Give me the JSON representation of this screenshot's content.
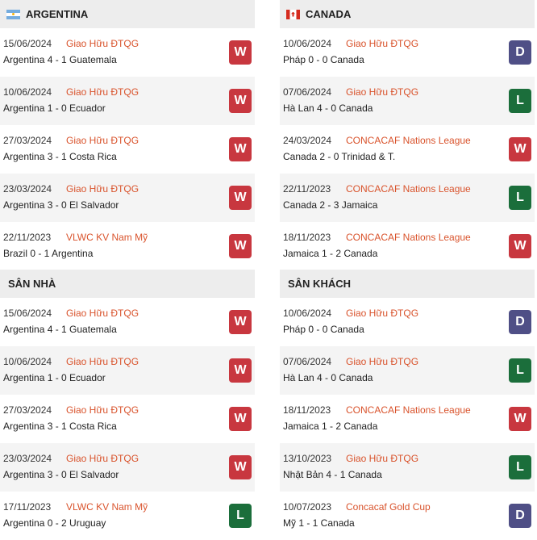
{
  "argentina": {
    "title": "ARGENTINA",
    "flag_icon": "argentina-flag-icon",
    "matches": [
      {
        "date": "15/06/2024",
        "competition": "Giao Hữu ĐTQG",
        "score": "Argentina 4 - 1 Guatemala",
        "result": "W"
      },
      {
        "date": "10/06/2024",
        "competition": "Giao Hữu ĐTQG",
        "score": "Argentina 1 - 0 Ecuador",
        "result": "W"
      },
      {
        "date": "27/03/2024",
        "competition": "Giao Hữu ĐTQG",
        "score": "Argentina 3 - 1 Costa Rica",
        "result": "W"
      },
      {
        "date": "23/03/2024",
        "competition": "Giao Hữu ĐTQG",
        "score": "Argentina 3 - 0 El Salvador",
        "result": "W"
      },
      {
        "date": "22/11/2023",
        "competition": "VLWC KV Nam Mỹ",
        "score": "Brazil 0 - 1 Argentina",
        "result": "W"
      }
    ]
  },
  "canada": {
    "title": "CANADA",
    "flag_icon": "canada-flag-icon",
    "matches": [
      {
        "date": "10/06/2024",
        "competition": "Giao Hữu ĐTQG",
        "score": "Pháp 0 - 0 Canada",
        "result": "D"
      },
      {
        "date": "07/06/2024",
        "competition": "Giao Hữu ĐTQG",
        "score": "Hà Lan 4 - 0 Canada",
        "result": "L"
      },
      {
        "date": "24/03/2024",
        "competition": "CONCACAF Nations League",
        "score": "Canada 2 - 0 Trinidad & T.",
        "result": "W"
      },
      {
        "date": "22/11/2023",
        "competition": "CONCACAF Nations League",
        "score": "Canada 2 - 3 Jamaica",
        "result": "L"
      },
      {
        "date": "18/11/2023",
        "competition": "CONCACAF Nations League",
        "score": "Jamaica 1 - 2 Canada",
        "result": "W"
      }
    ]
  },
  "home": {
    "title": "SÂN NHÀ",
    "matches": [
      {
        "date": "15/06/2024",
        "competition": "Giao Hữu ĐTQG",
        "score": "Argentina 4 - 1 Guatemala",
        "result": "W"
      },
      {
        "date": "10/06/2024",
        "competition": "Giao Hữu ĐTQG",
        "score": "Argentina 1 - 0 Ecuador",
        "result": "W"
      },
      {
        "date": "27/03/2024",
        "competition": "Giao Hữu ĐTQG",
        "score": "Argentina 3 - 1 Costa Rica",
        "result": "W"
      },
      {
        "date": "23/03/2024",
        "competition": "Giao Hữu ĐTQG",
        "score": "Argentina 3 - 0 El Salvador",
        "result": "W"
      },
      {
        "date": "17/11/2023",
        "competition": "VLWC KV Nam Mỹ",
        "score": "Argentina 0 - 2 Uruguay",
        "result": "L"
      }
    ]
  },
  "away": {
    "title": "SÂN KHÁCH",
    "matches": [
      {
        "date": "10/06/2024",
        "competition": "Giao Hữu ĐTQG",
        "score": "Pháp 0 - 0 Canada",
        "result": "D"
      },
      {
        "date": "07/06/2024",
        "competition": "Giao Hữu ĐTQG",
        "score": "Hà Lan 4 - 0 Canada",
        "result": "L"
      },
      {
        "date": "18/11/2023",
        "competition": "CONCACAF Nations League",
        "score": "Jamaica 1 - 2 Canada",
        "result": "W"
      },
      {
        "date": "13/10/2023",
        "competition": "Giao Hữu ĐTQG",
        "score": "Nhật Bản 4 - 1 Canada",
        "result": "L"
      },
      {
        "date": "10/07/2023",
        "competition": "Concacaf Gold Cup",
        "score": "Mỹ 1 - 1 Canada",
        "result": "D"
      }
    ]
  },
  "colors": {
    "win": "#c8373f",
    "draw": "#4f4f86",
    "loss": "#1b6e3b",
    "competition": "#d9532c",
    "header_bg": "#ededed"
  }
}
